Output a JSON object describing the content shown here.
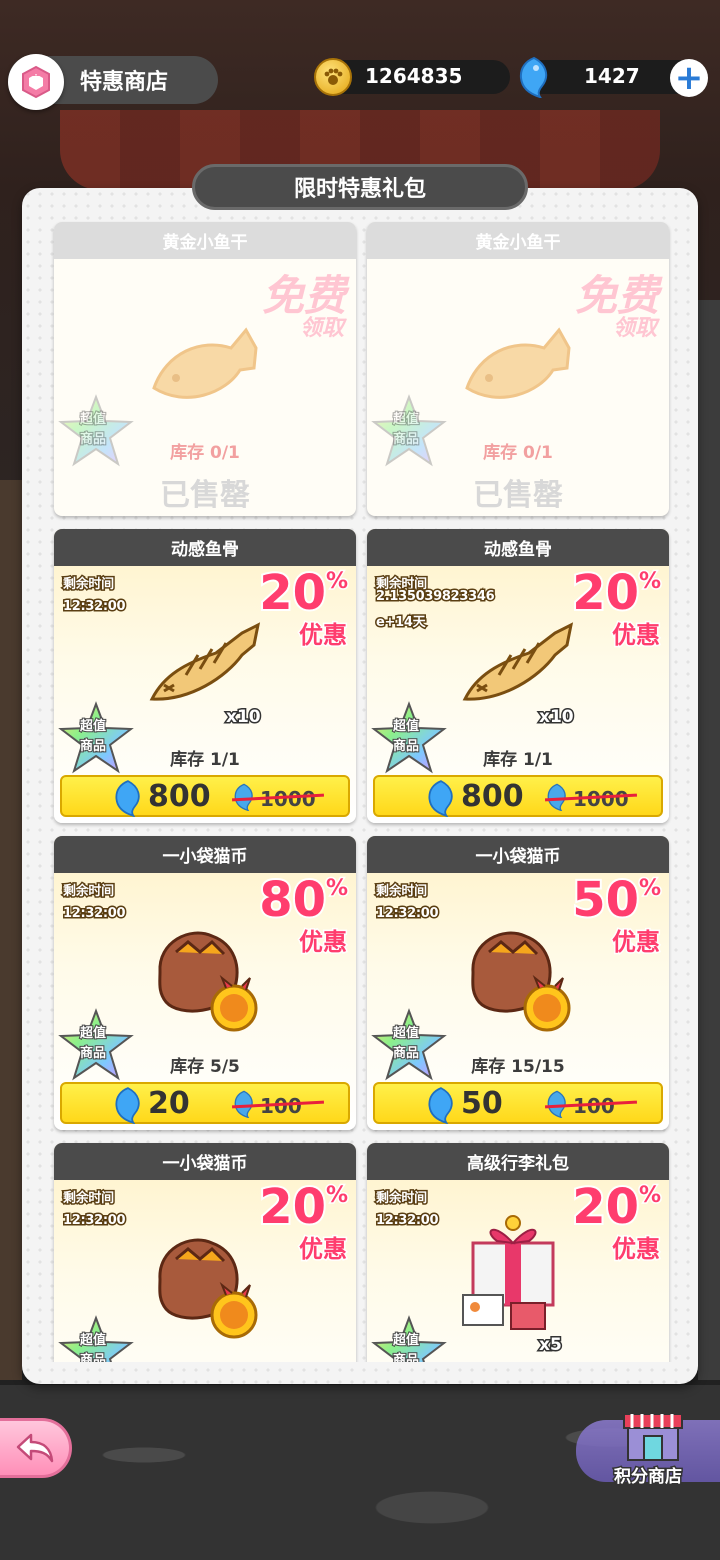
{
  "header": {
    "shop_title": "特惠商店",
    "coins": "1264835",
    "gems": "1427"
  },
  "panel": {
    "title": "限时特惠礼包"
  },
  "icons": {
    "shop": "shop-hexagon-icon",
    "coin": "paw-coin-icon",
    "gem": "blue-fish-gem-icon",
    "add": "plus-icon",
    "back": "back-arrow-icon",
    "points_shop": "storefront-icon"
  },
  "colors": {
    "discount": "#ff3d6e",
    "price_bar": "#ffd81a",
    "header_bg": "#4b4b4b"
  },
  "cards": [
    {
      "title": "黄金小鱼干",
      "free_big": "免费",
      "free_small": "领取",
      "star_line1": "超值",
      "star_line2": "商品",
      "stock": "库存 0/1",
      "soldout": "已售罄",
      "item_icon": "golden-fish-icon"
    },
    {
      "title": "黄金小鱼干",
      "free_big": "免费",
      "free_small": "领取",
      "star_line1": "超值",
      "star_line2": "商品",
      "stock": "库存 0/1",
      "soldout": "已售罄",
      "item_icon": "golden-fish-icon"
    },
    {
      "title": "动感鱼骨",
      "timer_label": "剩余时间",
      "timer_value": "12:32:00",
      "discount": "20",
      "pct": "%",
      "discount_word": "优惠",
      "qty": "x10",
      "star_line1": "超值",
      "star_line2": "商品",
      "stock": "库存 1/1",
      "price": "800",
      "old_price": "1000",
      "item_icon": "fish-bone-icon"
    },
    {
      "title": "动感鱼骨",
      "timer_label": "剩余时间",
      "timer_value": "2.135039823346",
      "timer_extra": "e+14天",
      "discount": "20",
      "pct": "%",
      "discount_word": "优惠",
      "qty": "x10",
      "star_line1": "超值",
      "star_line2": "商品",
      "stock": "库存 1/1",
      "price": "800",
      "old_price": "1000",
      "item_icon": "fish-bone-icon"
    },
    {
      "title": "一小袋猫币",
      "timer_label": "剩余时间",
      "timer_value": "12:32:00",
      "discount": "80",
      "pct": "%",
      "discount_word": "优惠",
      "star_line1": "超值",
      "star_line2": "商品",
      "stock": "库存 5/5",
      "price": "20",
      "old_price": "100",
      "item_icon": "coin-bag-icon"
    },
    {
      "title": "一小袋猫币",
      "timer_label": "剩余时间",
      "timer_value": "12:32:00",
      "discount": "50",
      "pct": "%",
      "discount_word": "优惠",
      "star_line1": "超值",
      "star_line2": "商品",
      "stock": "库存 15/15",
      "price": "50",
      "old_price": "100",
      "item_icon": "coin-bag-icon"
    },
    {
      "title": "一小袋猫币",
      "timer_label": "剩余时间",
      "timer_value": "12:32:00",
      "discount": "20",
      "pct": "%",
      "discount_word": "优惠",
      "star_line1": "超值",
      "star_line2": "商品",
      "item_icon": "coin-bag-icon"
    },
    {
      "title": "高级行李礼包",
      "timer_label": "剩余时间",
      "timer_value": "12:32:00",
      "discount": "20",
      "pct": "%",
      "discount_word": "优惠",
      "qty": "x5",
      "star_line1": "超值",
      "star_line2": "商品",
      "item_icon": "gift-box-icon"
    }
  ],
  "bottom": {
    "points_shop": "积分商店"
  }
}
